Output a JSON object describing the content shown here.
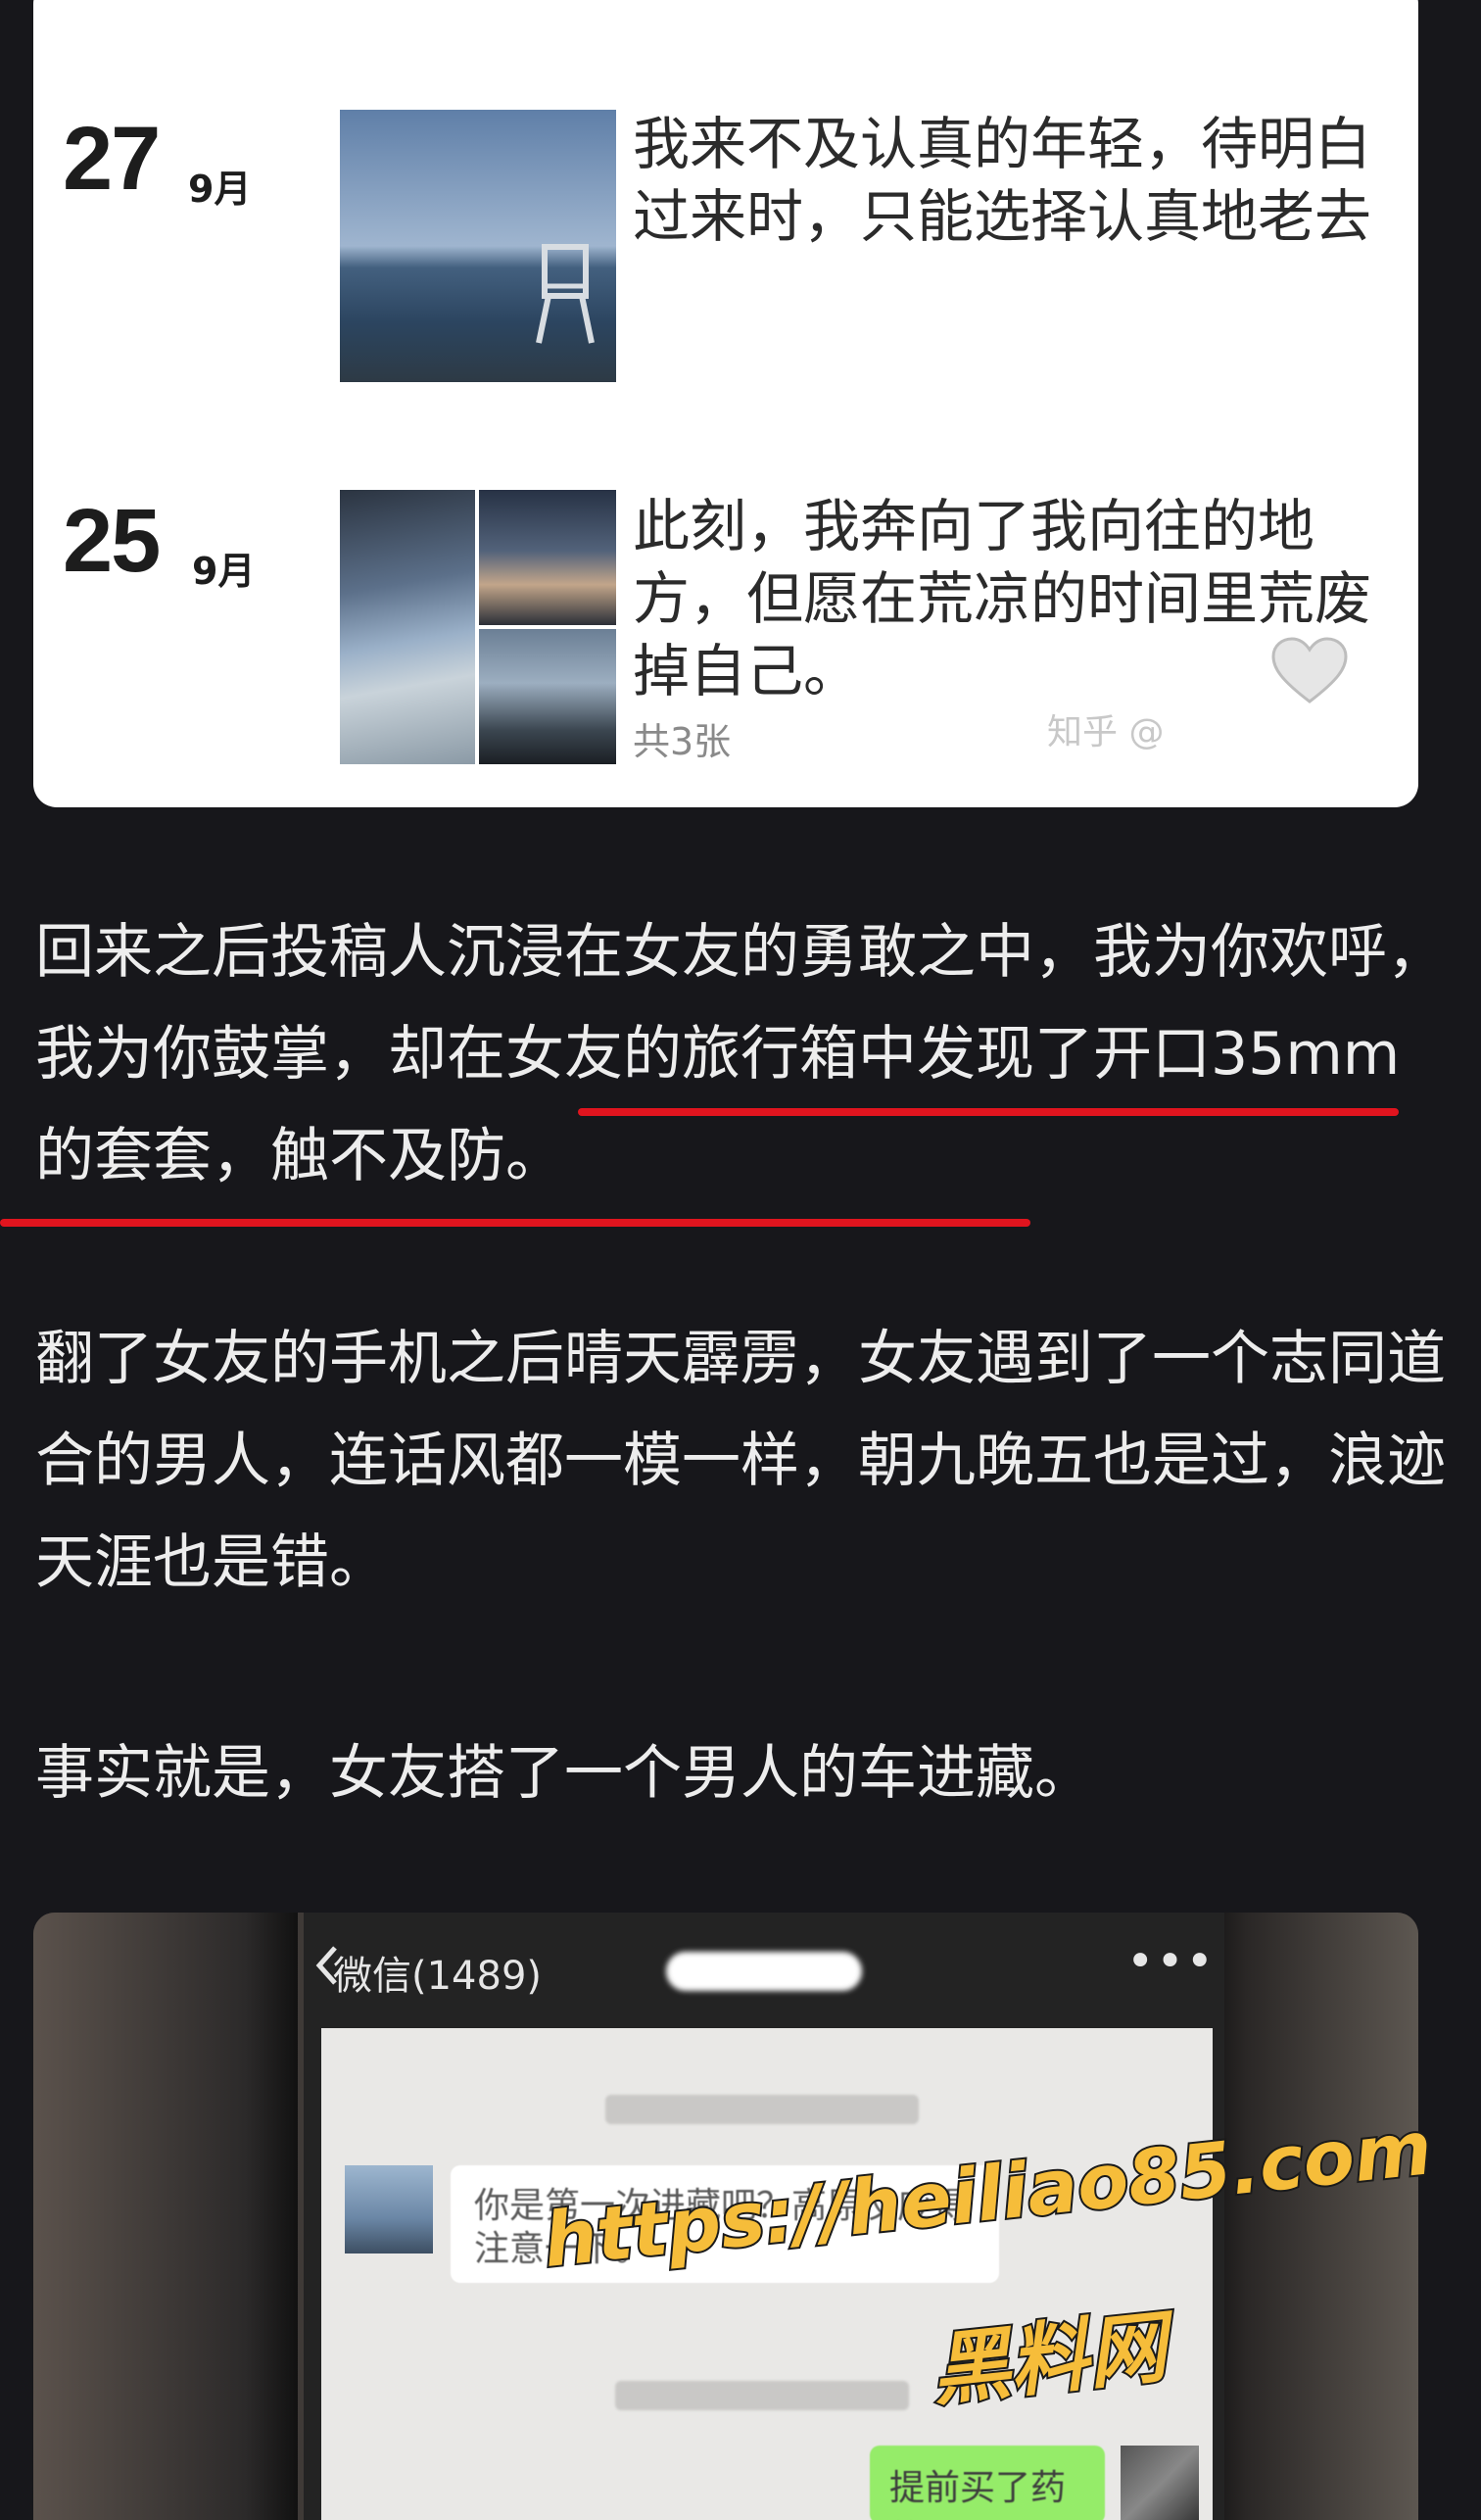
{
  "moments": [
    {
      "day": "27",
      "month": "9月",
      "text": "我来不及认真的年轻，待明白过来时，只能选择认真地老去"
    },
    {
      "day": "25",
      "month": "9月",
      "text": "此刻，我奔向了我向往的地方，但愿在荒凉的时间里荒废掉自己。",
      "photo_count": "共3张"
    }
  ],
  "card_watermark": "知乎 @",
  "article": {
    "p1_before": "回来之后投稿人沉浸在女友的勇敢之中，我为你欢呼，我为你鼓掌，",
    "p1_highlight": "却在女友的旅行箱中发现了开口35mm的套套，触不及防。",
    "p2": "翻了女友的手机之后晴天霹雳，女友遇到了一个志同道合的男人，连话风都一模一样，朝九晚五也是过，浪迹天涯也是错。",
    "p3": "事实就是，女友搭了一个男人的车进藏。"
  },
  "chat": {
    "back_label": "微信(1489)",
    "more_label": "•••",
    "incoming_message": "你是第一次进藏吧？高原反应得注意一下。",
    "outgoing_message": "提前买了药的"
  },
  "overlay": {
    "url": "https://heiliao85.com",
    "name": "黑料网"
  },
  "colors": {
    "background": "#17171b",
    "underline": "#e0141e",
    "overlay_text": "#f6bd3a"
  }
}
